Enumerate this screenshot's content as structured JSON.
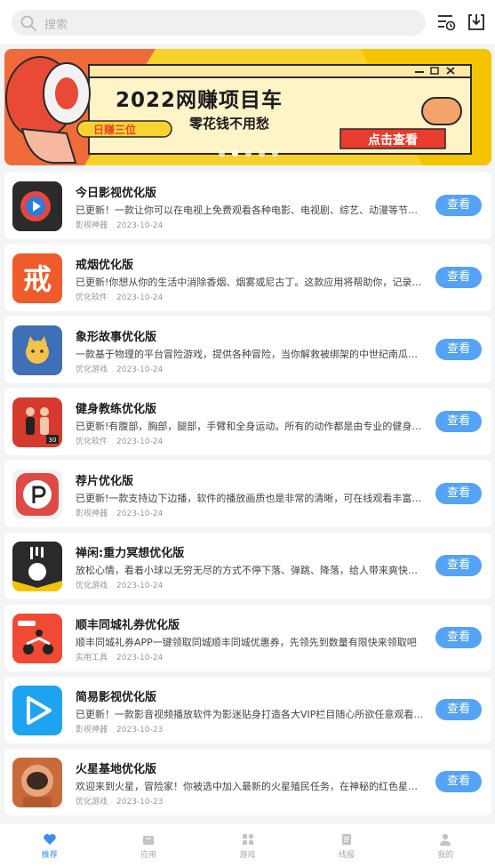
{
  "search": {
    "placeholder": "搜索"
  },
  "icons": {
    "search": "search-icon",
    "filter": "list-clock-icon",
    "download": "download-tray-icon"
  },
  "banner": {
    "title": "2022网赚项目车",
    "tag": "日赚三位",
    "slogan": "零花钱不用愁",
    "cta": "点击查看",
    "slide_count": 5,
    "active_slide": 2
  },
  "apps": [
    {
      "title": "今日影视优化版",
      "desc": "已更新！一款让你可以在电视上免费观看各种电影、电视剧、综艺、动漫等节目的应用",
      "category": "影视神器",
      "date": "2023-10-24",
      "button": "查看",
      "icon": "play-circle-icon"
    },
    {
      "title": "戒烟优化版",
      "desc": "已更新!你想从你的生活中消除香烟、烟雾或尼古丁。这款应用将帮助你，记录你戒烟的每一天",
      "category": "优化软件",
      "date": "2023-10-24",
      "button": "查看",
      "icon": "quit-smoking-icon"
    },
    {
      "title": "象形故事优化版",
      "desc": "一款基于物理的平台冒险游戏，提供各种冒险，当你解救被绑架的中世纪南瓜王子",
      "category": "优化游戏",
      "date": "2023-10-24",
      "button": "查看",
      "icon": "cat-character-icon"
    },
    {
      "title": "健身教练优化版",
      "desc": "已更新!有腹部，胸部，腿部，手臂和全身运动。所有的动作都是由专业的健身教练设计",
      "category": "优化软件",
      "date": "2023-10-24",
      "button": "查看",
      "icon": "fitness-coach-icon"
    },
    {
      "title": "荐片优化版",
      "desc": "已更新!一款支持边下边播，软件的播放画质也是非常的清晰，可在线观看丰富的影视资源",
      "category": "影视神器",
      "date": "2023-10-24",
      "button": "查看",
      "icon": "film-reel-icon"
    },
    {
      "title": "禅闲:重力冥想优化版",
      "desc": "放松心情，看着小球以无穷无尽的方式不停下落、弹跳、降落，给人带来爽快的体验",
      "category": "优化游戏",
      "date": "2023-10-24",
      "button": "查看",
      "icon": "falling-ball-icon"
    },
    {
      "title": "顺丰同城礼券优化版",
      "desc": "顺丰同城礼券APP一键领取同城顺丰同城优惠券，先领先到数量有限快来领取吧",
      "category": "实用工具",
      "date": "2023-10-24",
      "button": "查看",
      "icon": "delivery-scooter-icon"
    },
    {
      "title": "简易影视优化版",
      "desc": "已更新！一款影音视频播放软件为影迷贴身打造各大VIP栏目随心所欲任意观看各种影视",
      "category": "影视神器",
      "date": "2023-10-23",
      "button": "查看",
      "icon": "play-triangle-icon"
    },
    {
      "title": "火星基地优化版",
      "desc": "欢迎来到火星，冒险家！你被选中加入最新的火星殖民任务，在神秘的红色星球上建立基地",
      "category": "优化游戏",
      "date": "2023-10-23",
      "button": "查看",
      "icon": "astronaut-helmet-icon"
    }
  ],
  "tabs": [
    {
      "label": "推荐",
      "icon": "heart-icon",
      "active": true
    },
    {
      "label": "应用",
      "icon": "bag-icon",
      "active": false
    },
    {
      "label": "游戏",
      "icon": "grid-icon",
      "active": false
    },
    {
      "label": "线报",
      "icon": "news-icon",
      "active": false
    },
    {
      "label": "我的",
      "icon": "user-icon",
      "active": false
    }
  ],
  "colors": {
    "accent": "#55a3f4",
    "tab_active": "#3b8ef0",
    "background": "#f3f4f6"
  }
}
